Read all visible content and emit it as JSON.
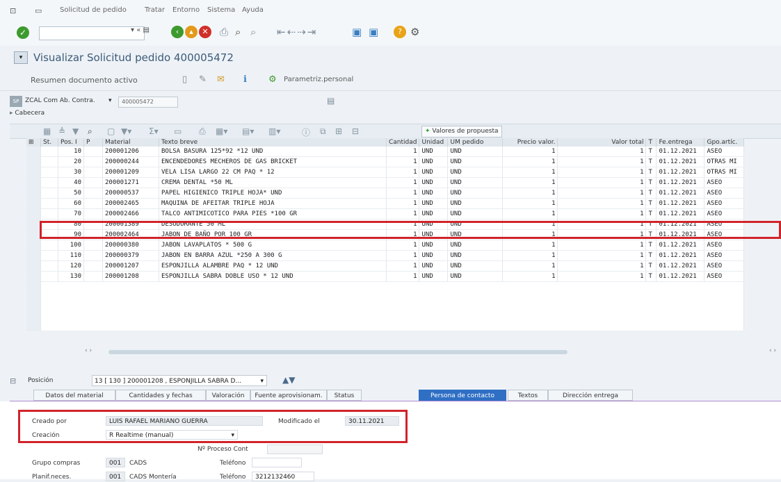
{
  "menubar": {
    "items": [
      "Solicitud de pedido",
      "Tratar",
      "Entorno",
      "Sistema",
      "Ayuda"
    ]
  },
  "title": "Visualizar Solicitud pedido 400005472",
  "appbar": {
    "summary": "Resumen documento activo",
    "personal_settings": "Parametriz.personal"
  },
  "doc_selector": {
    "type": "ZCAL Com Ab. Contra.",
    "number": "400005472"
  },
  "header_label": "Cabecera",
  "proposal_button": "Valores de propuesta",
  "table": {
    "columns": [
      "St.",
      "Pos. I",
      "P",
      "Material",
      "Texto breve",
      "Cantidad",
      "Unidad",
      "UM pedido",
      "Precio valor.",
      "Valor total",
      "T",
      "Fe.entrega",
      "Gpo.artíc."
    ],
    "rows": [
      {
        "pos": "10",
        "material": "200001206",
        "text": "BOLSA BASURA 125*92  *12 UND",
        "qty": "1",
        "unit": "UND",
        "um": "UND",
        "price": "1",
        "total": "1",
        "t": "T",
        "date": "01.12.2021",
        "group": "ASEO"
      },
      {
        "pos": "20",
        "material": "200000244",
        "text": "ENCENDEDORES MECHEROS DE GAS BRICKET",
        "qty": "1",
        "unit": "UND",
        "um": "UND",
        "price": "1",
        "total": "1",
        "t": "T",
        "date": "01.12.2021",
        "group": "OTRAS MI"
      },
      {
        "pos": "30",
        "material": "200001209",
        "text": "VELA LISA LARGO 22 CM PAQ * 12",
        "qty": "1",
        "unit": "UND",
        "um": "UND",
        "price": "1",
        "total": "1",
        "t": "T",
        "date": "01.12.2021",
        "group": "OTRAS MI"
      },
      {
        "pos": "40",
        "material": "200001271",
        "text": "CREMA DENTAL *50 ML",
        "qty": "1",
        "unit": "UND",
        "um": "UND",
        "price": "1",
        "total": "1",
        "t": "T",
        "date": "01.12.2021",
        "group": "ASEO"
      },
      {
        "pos": "50",
        "material": "200000537",
        "text": "PAPEL HIGIENICO TRIPLE HOJA* UND",
        "qty": "1",
        "unit": "UND",
        "um": "UND",
        "price": "1",
        "total": "1",
        "t": "T",
        "date": "01.12.2021",
        "group": "ASEO"
      },
      {
        "pos": "60",
        "material": "200002465",
        "text": "MAQUINA DE AFEITAR TRIPLE HOJA",
        "qty": "1",
        "unit": "UND",
        "um": "UND",
        "price": "1",
        "total": "1",
        "t": "T",
        "date": "01.12.2021",
        "group": "ASEO"
      },
      {
        "pos": "70",
        "material": "200002466",
        "text": "TALCO ANTIMICOTICO PARA PIES *100 GR",
        "qty": "1",
        "unit": "UND",
        "um": "UND",
        "price": "1",
        "total": "1",
        "t": "T",
        "date": "01.12.2021",
        "group": "ASEO"
      },
      {
        "pos": "80",
        "material": "200001389",
        "text": "DESODORANTE 50 ML",
        "qty": "1",
        "unit": "UND",
        "um": "UND",
        "price": "1",
        "total": "1",
        "t": "T",
        "date": "01.12.2021",
        "group": "ASEO"
      },
      {
        "pos": "90",
        "material": "200002464",
        "text": "JABON DE BAÑO POR 100 GR",
        "qty": "1",
        "unit": "UND",
        "um": "UND",
        "price": "1",
        "total": "1",
        "t": "T",
        "date": "01.12.2021",
        "group": "ASEO"
      },
      {
        "pos": "100",
        "material": "200000380",
        "text": "JABON LAVAPLATOS * 500 G",
        "qty": "1",
        "unit": "UND",
        "um": "UND",
        "price": "1",
        "total": "1",
        "t": "T",
        "date": "01.12.2021",
        "group": "ASEO"
      },
      {
        "pos": "110",
        "material": "200000379",
        "text": "JABON EN BARRA AZUL *250  A 300 G",
        "qty": "1",
        "unit": "UND",
        "um": "UND",
        "price": "1",
        "total": "1",
        "t": "T",
        "date": "01.12.2021",
        "group": "ASEO"
      },
      {
        "pos": "120",
        "material": "200001207",
        "text": "ESPONJILLA ALAMBRE PAQ * 12 UND",
        "qty": "1",
        "unit": "UND",
        "um": "UND",
        "price": "1",
        "total": "1",
        "t": "T",
        "date": "01.12.2021",
        "group": "ASEO"
      },
      {
        "pos": "130",
        "material": "200001208",
        "text": "ESPONJILLA SABRA DOBLE USO * 12 UND",
        "qty": "1",
        "unit": "UND",
        "um": "UND",
        "price": "1",
        "total": "1",
        "t": "T",
        "date": "01.12.2021",
        "group": "ASEO"
      }
    ]
  },
  "position": {
    "label": "Posición",
    "selected": "13 [ 130 ] 200001208 , ESPONJILLA SABRA D..."
  },
  "tabs": [
    "Datos del material",
    "Cantidades y fechas",
    "Valoración",
    "Fuente aprovisionam.",
    "Status",
    "Persona de contacto",
    "Textos",
    "Dirección entrega"
  ],
  "contact": {
    "created_by_label": "Creado por",
    "created_by": "LUIS RAFAEL MARIANO GUERRA",
    "modified_label": "Modificado el",
    "modified": "30.11.2021",
    "creation_label": "Creación",
    "creation": "R Realtime (manual)",
    "process_label": "Nº Proceso Cont",
    "group_label": "Grupo compras",
    "group_code": "001",
    "group_name": "CADS",
    "phone_label": "Teléfono",
    "planner_label": "Planif.neces.",
    "planner_code": "001",
    "planner_name": "CADS Montería",
    "phone2_label": "Teléfono",
    "phone2": "3212132460"
  }
}
